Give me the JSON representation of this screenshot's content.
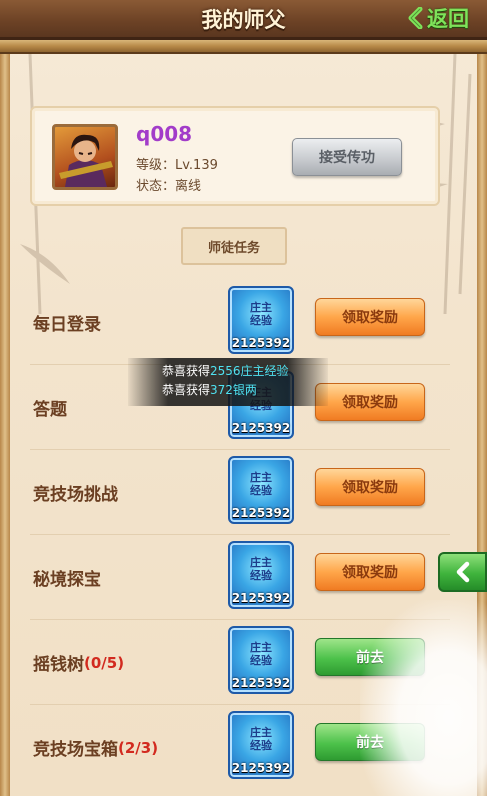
{
  "header": {
    "title": "我的师父",
    "back_label": "返回"
  },
  "profile": {
    "name": "q008",
    "level": "等级：Lv.139",
    "status": "状态：离线",
    "accept_button": "接受传功"
  },
  "section_label": "师徒任务",
  "reward_icon_lines": [
    "庄主",
    "经验"
  ],
  "tasks": [
    {
      "name": "每日登录",
      "count": "",
      "reward_amount": "2125392",
      "action": "领取奖励",
      "action_type": "claim"
    },
    {
      "name": "答题",
      "count": "",
      "reward_amount": "2125392",
      "action": "领取奖励",
      "action_type": "claim"
    },
    {
      "name": "竞技场挑战",
      "count": "",
      "reward_amount": "2125392",
      "action": "领取奖励",
      "action_type": "claim"
    },
    {
      "name": "秘境探宝",
      "count": "",
      "reward_amount": "2125392",
      "action": "领取奖励",
      "action_type": "claim"
    },
    {
      "name": "摇钱树",
      "count": "(0/5)",
      "reward_amount": "2125392",
      "action": "前去",
      "action_type": "go"
    },
    {
      "name": "竞技场宝箱",
      "count": "(2/3)",
      "reward_amount": "2125392",
      "action": "前去",
      "action_type": "go"
    }
  ],
  "toast": {
    "line1_prefix": "恭喜获得",
    "line1_value": "2556庄主经验",
    "line2_prefix": "恭喜获得",
    "line2_value": "372银两"
  },
  "colors": {
    "header_bg": "#6e4326",
    "back_green": "#7fe35a",
    "name_purple": "#a23cc9",
    "claim_orange": "#ffa64a",
    "go_green": "#4cc14a",
    "count_red": "#d22a1f",
    "toast_highlight": "#4fe1f0"
  },
  "icons": [
    "back-chevron-icon",
    "avatar-portrait",
    "reward-exp-icon",
    "collapse-chevron-icon"
  ]
}
